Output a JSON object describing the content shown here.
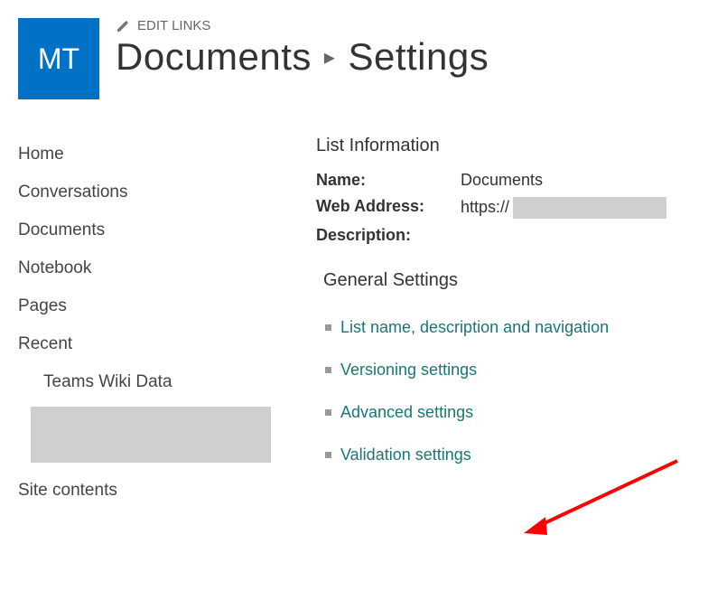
{
  "header": {
    "site_tile": "MT",
    "edit_links_label": "EDIT LINKS",
    "breadcrumb": {
      "parent": "Documents",
      "current": "Settings"
    }
  },
  "nav": {
    "items": [
      "Home",
      "Conversations",
      "Documents",
      "Notebook",
      "Pages",
      "Recent"
    ],
    "recent_sub": "Teams Wiki Data",
    "site_contents": "Site contents"
  },
  "list_info": {
    "heading": "List Information",
    "name_label": "Name:",
    "name_value": "Documents",
    "web_label": "Web Address:",
    "web_value": "https://",
    "desc_label": "Description:"
  },
  "general_settings": {
    "heading": "General Settings",
    "items": [
      "List name, description and navigation",
      "Versioning settings",
      "Advanced settings",
      "Validation settings"
    ]
  }
}
